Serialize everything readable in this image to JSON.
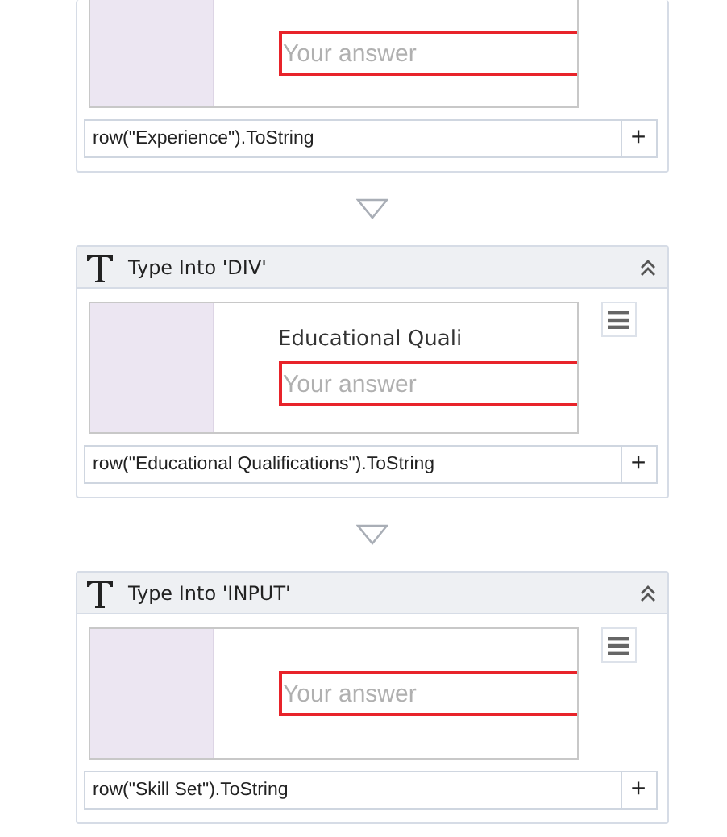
{
  "activities": [
    {
      "kind": "partial",
      "placeholder": "Your answer",
      "expression": "row(\"Experience\").ToString",
      "add": "+"
    },
    {
      "kind": "full",
      "title": "Type Into 'DIV'",
      "preview_heading": "Educational Quali",
      "placeholder": "Your answer",
      "expression": "row(\"Educational Qualifications\").ToString",
      "add": "+"
    },
    {
      "kind": "full",
      "title": "Type Into 'INPUT'",
      "placeholder": "Your answer",
      "expression": "row(\"Skill Set\").ToString",
      "add": "+"
    }
  ]
}
